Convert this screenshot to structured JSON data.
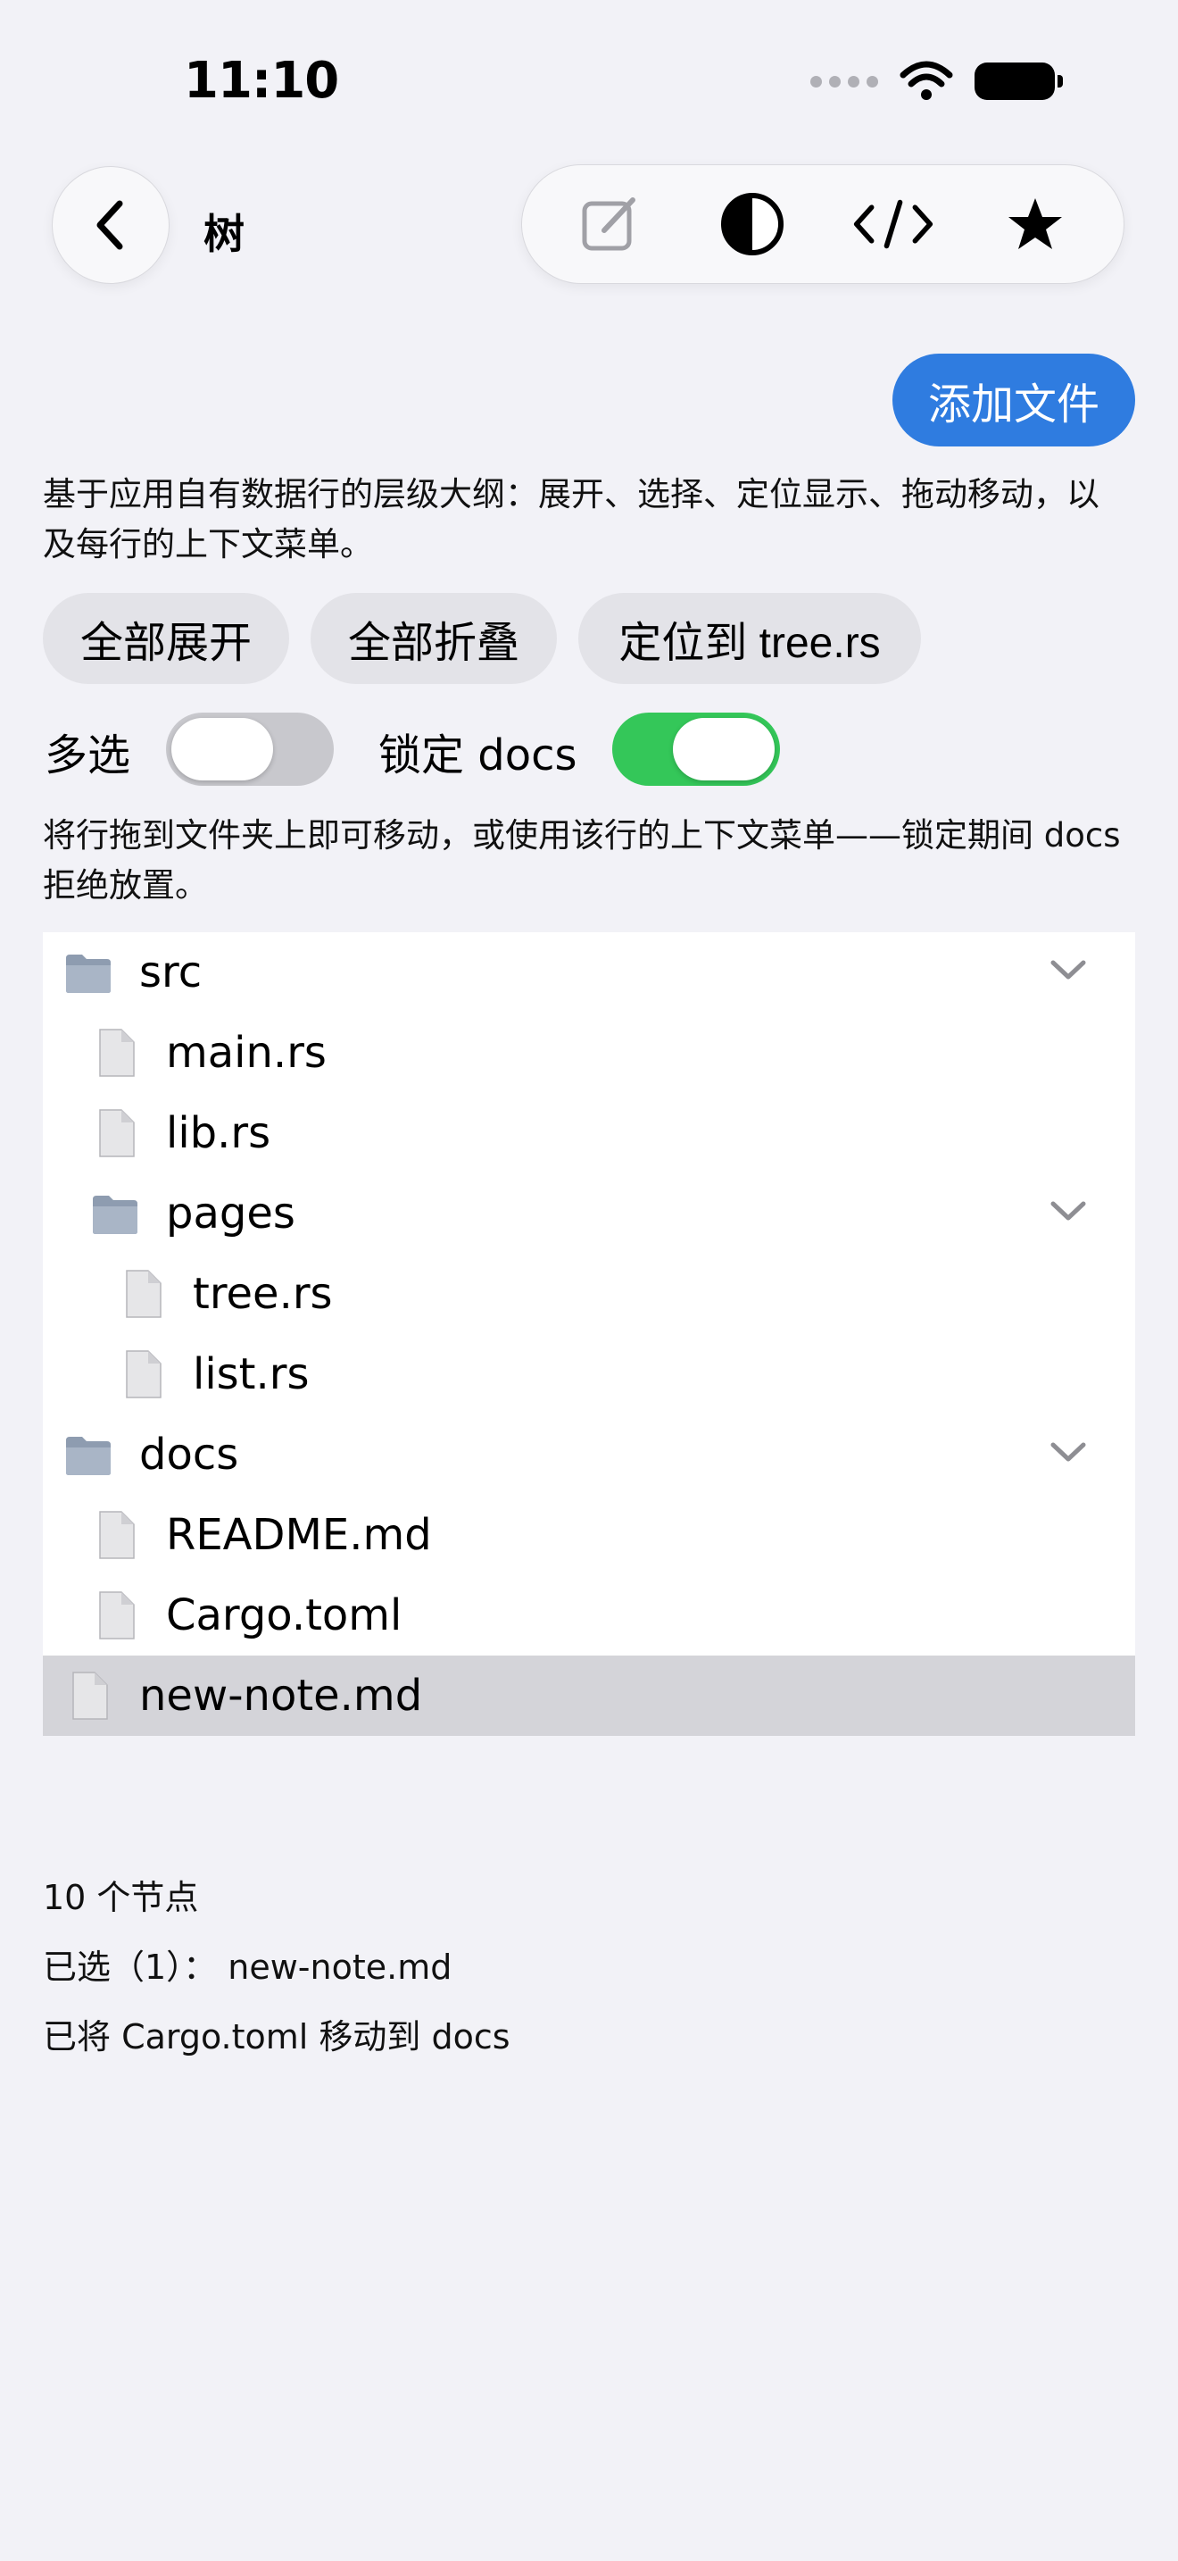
{
  "status_bar": {
    "time": "11:10"
  },
  "nav": {
    "title": "树"
  },
  "toolbar": {
    "icons": [
      "compose-icon",
      "contrast-icon",
      "code-icon",
      "star-icon"
    ]
  },
  "actions": {
    "add_file": "添加文件"
  },
  "description": "基于应用自有数据行的层级大纲：展开、选择、定位显示、拖动移动，以及每行的上下文菜单。",
  "chips": {
    "expand_all": "全部展开",
    "collapse_all": "全部折叠",
    "reveal": "定位到 tree.rs"
  },
  "toggles": {
    "multiselect": {
      "label": "多选",
      "on": false
    },
    "lock_docs": {
      "label": "锁定 docs",
      "on": true
    }
  },
  "hint": "将行拖到文件夹上即可移动，或使用该行的上下文菜单——锁定期间 docs 拒绝放置。",
  "tree": [
    {
      "name": "src",
      "type": "folder",
      "level": 0,
      "expanded": true
    },
    {
      "name": "main.rs",
      "type": "file",
      "level": 1
    },
    {
      "name": "lib.rs",
      "type": "file",
      "level": 1
    },
    {
      "name": "pages",
      "type": "folder",
      "level": 1,
      "expanded": true
    },
    {
      "name": "tree.rs",
      "type": "file",
      "level": 2
    },
    {
      "name": "list.rs",
      "type": "file",
      "level": 2
    },
    {
      "name": "docs",
      "type": "folder",
      "level": 0,
      "expanded": true
    },
    {
      "name": "README.md",
      "type": "file",
      "level": 1
    },
    {
      "name": "Cargo.toml",
      "type": "file",
      "level": 1
    },
    {
      "name": "new-note.md",
      "type": "file",
      "level": 0,
      "selected": true
    }
  ],
  "stats": {
    "node_count": "10 个节点",
    "selected": "已选（1）： new-note.md",
    "last_move": "已将 Cargo.toml 移动到 docs"
  },
  "colors": {
    "accent": "#2f7ce0",
    "switch_on": "#34c759",
    "switch_off": "#c8c8cd",
    "selection": "#d4d4d9"
  }
}
